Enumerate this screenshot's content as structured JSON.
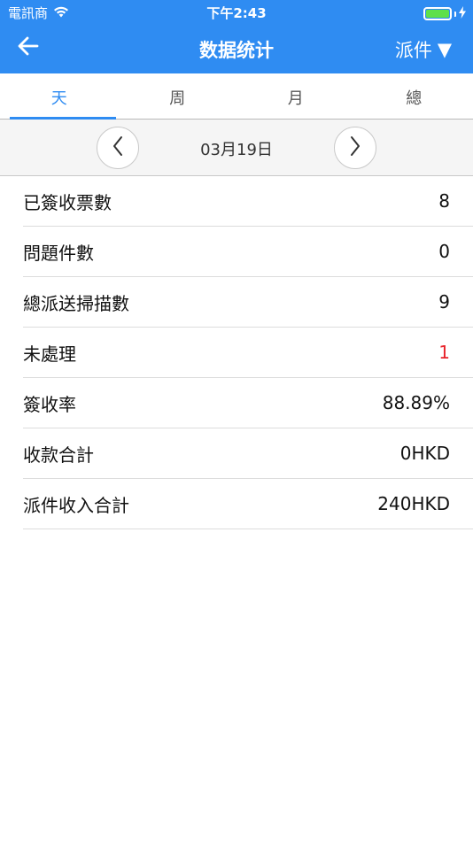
{
  "status_bar": {
    "carrier": "電訊商",
    "time": "下午2:43"
  },
  "nav": {
    "title": "数据统计",
    "menu_label": "派件",
    "menu_arrow": "▼"
  },
  "tabs": [
    {
      "label": "天",
      "active": true
    },
    {
      "label": "周",
      "active": false
    },
    {
      "label": "月",
      "active": false
    },
    {
      "label": "總",
      "active": false
    }
  ],
  "date_nav": {
    "date": "03月19日"
  },
  "stats": [
    {
      "label": "已簽收票數",
      "value": "8"
    },
    {
      "label": "問題件數",
      "value": "0"
    },
    {
      "label": "總派送掃描數",
      "value": "9"
    },
    {
      "label": "未處理",
      "value": "1",
      "color": "#e8232a"
    },
    {
      "label": "簽收率",
      "value": "88.89%"
    },
    {
      "label": "收款合計",
      "value": "0HKD"
    },
    {
      "label": "派件收入合計",
      "value": "240HKD"
    }
  ],
  "colors": {
    "accent": "#2f8cf2",
    "alert": "#e8232a",
    "battery": "#5ee04a"
  }
}
